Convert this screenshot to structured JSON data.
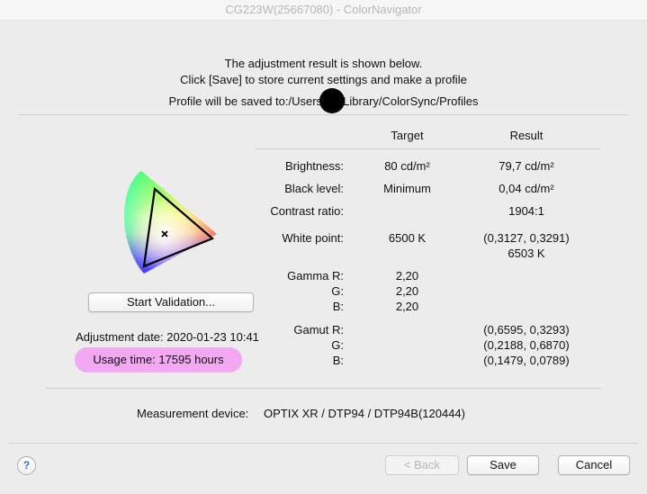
{
  "window": {
    "title": "CG223W(25667080) - ColorNavigator"
  },
  "message": {
    "line1": "The adjustment result is shown below.",
    "line2": "Click [Save] to store current settings and make a profile",
    "save_path": "Profile will be saved to:/Users/A      r/Library/ColorSync/Profiles"
  },
  "table": {
    "col_target": "Target",
    "col_result": "Result",
    "brightness": {
      "label": "Brightness:",
      "target": "80 cd/m²",
      "result": "79,7 cd/m²"
    },
    "black_level": {
      "label": "Black level:",
      "target": "Minimum",
      "result": "0,04 cd/m²"
    },
    "contrast": {
      "label": "Contrast ratio:",
      "target": "",
      "result": "1904:1"
    },
    "white_point": {
      "label": "White point:",
      "target": "6500 K",
      "result_xy": "(0,3127, 0,3291)",
      "result_k": "6503 K"
    },
    "gamma": {
      "label_r": "Gamma R:",
      "label_g": "G:",
      "label_b": "B:",
      "r": "2,20",
      "g": "2,20",
      "b": "2,20"
    },
    "gamut": {
      "label_r": "Gamut R:",
      "label_g": "G:",
      "label_b": "B:",
      "r": "(0,6595, 0,3293)",
      "g": "(0,2188, 0,6870)",
      "b": "(0,1479, 0,0789)"
    }
  },
  "left": {
    "start_validation": "Start Validation...",
    "adjustment_date": "Adjustment date: 2020-01-23 10:41",
    "usage_time": "Usage time: 17595 hours"
  },
  "measurement": {
    "label": "Measurement device:",
    "value": "OPTIX XR / DTP94 / DTP94B(120444)"
  },
  "buttons": {
    "help": "?",
    "back": "< Back",
    "save": "Save",
    "cancel": "Cancel"
  },
  "colors": {
    "usage_badge": "#f2a9f2",
    "help_accent": "#2f6fd1"
  }
}
